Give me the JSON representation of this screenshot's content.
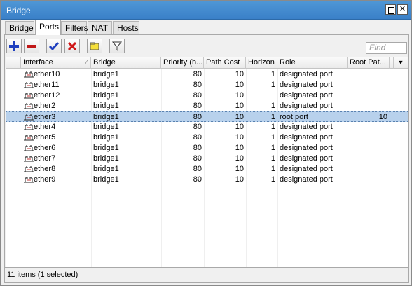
{
  "window": {
    "title": "Bridge"
  },
  "tabs": [
    "Bridge",
    "Ports",
    "Filters",
    "NAT",
    "Hosts"
  ],
  "active_tab": "Ports",
  "toolbar": {
    "find_placeholder": "Find"
  },
  "columns": [
    "Interface",
    "Bridge",
    "Priority (h...",
    "Path Cost",
    "Horizon",
    "Role",
    "Root Pat..."
  ],
  "rows": [
    {
      "interface": "ether10",
      "bridge": "bridge1",
      "priority": "80",
      "path_cost": "10",
      "horizon": "1",
      "role": "designated port",
      "root_path_cost": "",
      "selected": false
    },
    {
      "interface": "ether11",
      "bridge": "bridge1",
      "priority": "80",
      "path_cost": "10",
      "horizon": "1",
      "role": "designated port",
      "root_path_cost": "",
      "selected": false
    },
    {
      "interface": "ether12",
      "bridge": "bridge1",
      "priority": "80",
      "path_cost": "10",
      "horizon": "",
      "role": "designated port",
      "root_path_cost": "",
      "selected": false
    },
    {
      "interface": "ether2",
      "bridge": "bridge1",
      "priority": "80",
      "path_cost": "10",
      "horizon": "1",
      "role": "designated port",
      "root_path_cost": "",
      "selected": false
    },
    {
      "interface": "ether3",
      "bridge": "bridge1",
      "priority": "80",
      "path_cost": "10",
      "horizon": "1",
      "role": "root port",
      "root_path_cost": "10",
      "selected": true
    },
    {
      "interface": "ether4",
      "bridge": "bridge1",
      "priority": "80",
      "path_cost": "10",
      "horizon": "1",
      "role": "designated port",
      "root_path_cost": "",
      "selected": false
    },
    {
      "interface": "ether5",
      "bridge": "bridge1",
      "priority": "80",
      "path_cost": "10",
      "horizon": "1",
      "role": "designated port",
      "root_path_cost": "",
      "selected": false
    },
    {
      "interface": "ether6",
      "bridge": "bridge1",
      "priority": "80",
      "path_cost": "10",
      "horizon": "1",
      "role": "designated port",
      "root_path_cost": "",
      "selected": false
    },
    {
      "interface": "ether7",
      "bridge": "bridge1",
      "priority": "80",
      "path_cost": "10",
      "horizon": "1",
      "role": "designated port",
      "root_path_cost": "",
      "selected": false
    },
    {
      "interface": "ether8",
      "bridge": "bridge1",
      "priority": "80",
      "path_cost": "10",
      "horizon": "1",
      "role": "designated port",
      "root_path_cost": "",
      "selected": false
    },
    {
      "interface": "ether9",
      "bridge": "bridge1",
      "priority": "80",
      "path_cost": "10",
      "horizon": "1",
      "role": "designated port",
      "root_path_cost": "",
      "selected": false
    }
  ],
  "status": {
    "text": "11 items (1 selected)"
  },
  "colors": {
    "titlebar": "#3a80c8",
    "selection": "#b8d1ec",
    "add_icon": "#1f3fbf",
    "remove_icon": "#c01818",
    "enable_icon": "#1f3fbf",
    "disable_icon": "#d01818"
  }
}
